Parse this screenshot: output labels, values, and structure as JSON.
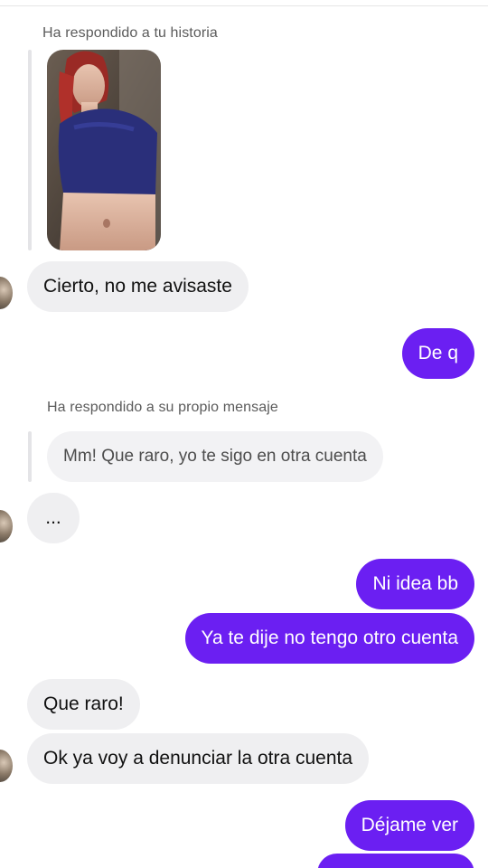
{
  "thread": {
    "story_reply_note": "Ha respondido a tu historia",
    "own_reply_note": "Ha respondido a su propio mensaje",
    "quoted_message": "Mm! Que raro, yo te sigo en otra cuenta"
  },
  "messages": [
    {
      "from": "them",
      "text": "Cierto, no me avisaste"
    },
    {
      "from": "me",
      "text": "De q"
    },
    {
      "from": "them",
      "text": "..."
    },
    {
      "from": "me",
      "text": "Ni idea bb"
    },
    {
      "from": "me",
      "text": "Ya te dije no tengo otro cuenta"
    },
    {
      "from": "them",
      "text": "Que raro!"
    },
    {
      "from": "them",
      "text": "Ok ya voy a denunciar la otra cuenta"
    },
    {
      "from": "me",
      "text": "Déjame ver"
    }
  ],
  "colors": {
    "outgoing_bubble": "#6b1ff2",
    "incoming_bubble": "#efeff1",
    "background": "#ffffff"
  }
}
